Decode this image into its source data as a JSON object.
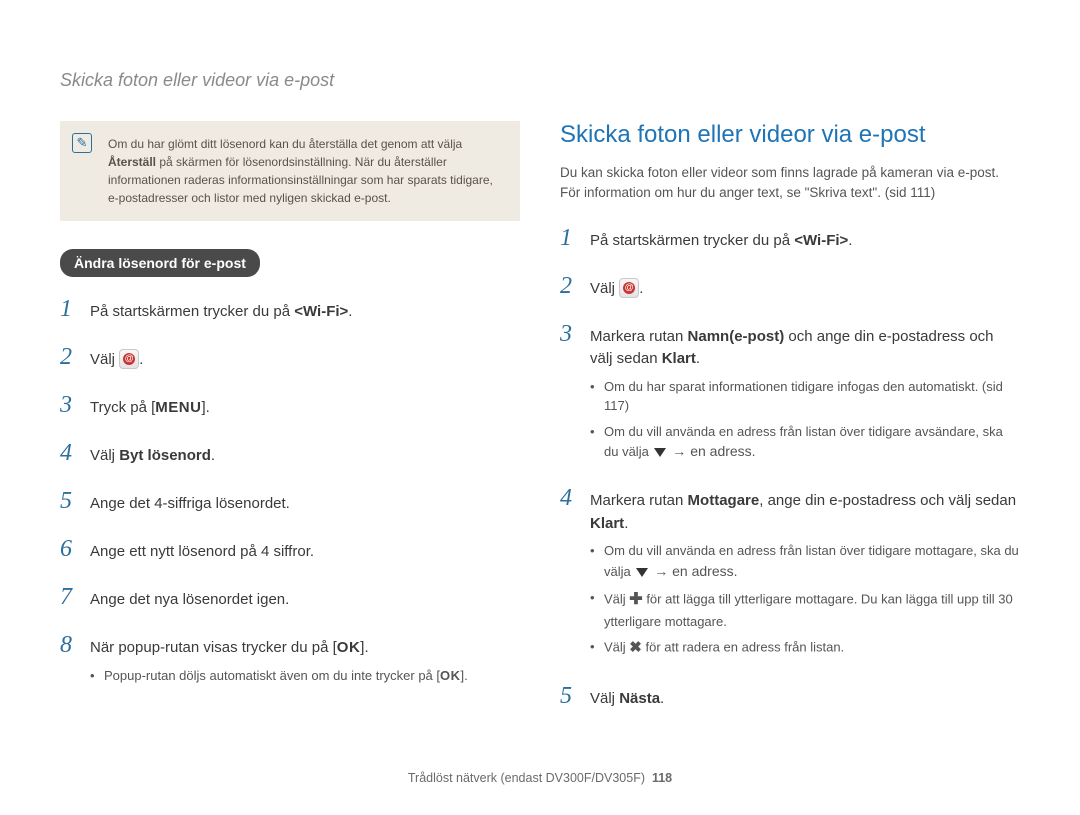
{
  "header": "Skicka foton eller videor via e-post",
  "note": {
    "line1_pre": "Om du har glömt ditt lösenord kan du återställa det genom att välja ",
    "bold1": "Återställ",
    "line2": " på skärmen för lösenordsinställning. När du återställer informationen raderas informationsinställningar som har sparats tidigare, e-postadresser och listor med nyligen skickad e-post."
  },
  "left": {
    "pill": "Ändra lösenord för e-post",
    "steps": [
      {
        "num": "1",
        "text_pre": "På startskärmen trycker du på ",
        "bold": "<Wi-Fi>",
        "text_post": "."
      },
      {
        "num": "2",
        "text_pre": "Välj ",
        "icon": "email",
        "text_post": "."
      },
      {
        "num": "3",
        "text_pre": "Tryck på [",
        "label": "MENU",
        "text_post": "]."
      },
      {
        "num": "4",
        "text_pre": "Välj ",
        "bold": "Byt lösenord",
        "text_post": "."
      },
      {
        "num": "5",
        "text_pre": "Ange det 4-siffriga lösenordet."
      },
      {
        "num": "6",
        "text_pre": "Ange ett nytt lösenord på 4 siffror."
      },
      {
        "num": "7",
        "text_pre": "Ange det nya lösenordet igen."
      },
      {
        "num": "8",
        "text_pre": "När popup-rutan visas trycker du på [",
        "label": "OK",
        "text_post": "].",
        "sub": [
          {
            "text_pre": "Popup-rutan döljs automatiskt även om du inte trycker på [",
            "label": "OK",
            "text_post": "]."
          }
        ]
      }
    ]
  },
  "right": {
    "title": "Skicka foton eller videor via e-post",
    "intro": "Du kan skicka foton eller videor som finns lagrade på kameran via e-post. För information om hur du anger text, se \"Skriva text\". (sid 111)",
    "steps": [
      {
        "num": "1",
        "text_pre": "På startskärmen trycker du på ",
        "bold": "<Wi-Fi>",
        "text_post": "."
      },
      {
        "num": "2",
        "text_pre": "Välj ",
        "icon": "email",
        "text_post": "."
      },
      {
        "num": "3",
        "text_pre": "Markera rutan ",
        "bold": "Namn(e-post)",
        "text_mid": " och ange din e-postadress och välj sedan ",
        "bold2": "Klart",
        "text_post": ".",
        "sub": [
          {
            "text": "Om du har sparat informationen tidigare infogas den automatiskt. (sid 117)"
          },
          {
            "text_pre": "Om du vill använda en adress från listan över tidigare avsändare, ska du välja ",
            "tri": true,
            "arrow": " → en adress."
          }
        ]
      },
      {
        "num": "4",
        "text_pre": "Markera rutan ",
        "bold": "Mottagare",
        "text_mid": ", ange din e-postadress och välj sedan ",
        "bold2": "Klart",
        "text_post": ".",
        "sub": [
          {
            "text_pre": "Om du vill använda en adress från listan över tidigare mottagare, ska du välja ",
            "tri": true,
            "arrow": " → en adress."
          },
          {
            "text_pre": "Välj ",
            "plus": true,
            "text_post": " för att lägga till ytterligare mottagare. Du kan lägga till upp till 30 ytterligare mottagare."
          },
          {
            "text_pre": "Välj ",
            "x": true,
            "text_post": " för att radera en adress från listan."
          }
        ]
      },
      {
        "num": "5",
        "text_pre": "Välj ",
        "bold": "Nästa",
        "text_post": "."
      }
    ]
  },
  "footer": {
    "text": "Trådlöst nätverk (endast DV300F/DV305F)",
    "page": "118"
  }
}
